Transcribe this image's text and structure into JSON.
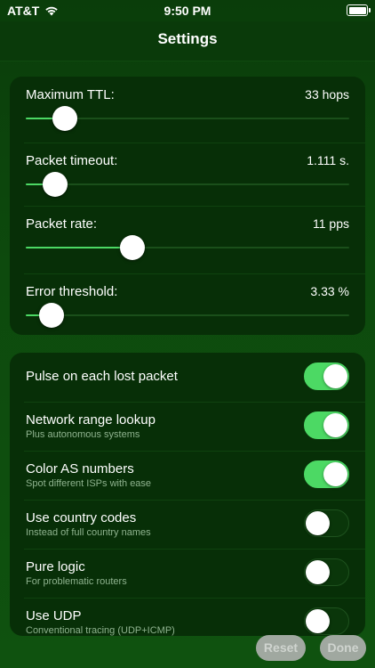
{
  "status": {
    "carrier": "AT&T",
    "time": "9:50 PM"
  },
  "nav": {
    "title": "Settings"
  },
  "sliders": [
    {
      "label": "Maximum TTL:",
      "value": "33 hops",
      "position": 0.12
    },
    {
      "label": "Packet timeout:",
      "value": "1.111 s.",
      "position": 0.09
    },
    {
      "label": "Packet rate:",
      "value": "11 pps",
      "position": 0.33
    },
    {
      "label": "Error threshold:",
      "value": "3.33 %",
      "position": 0.08
    }
  ],
  "toggles": [
    {
      "title": "Pulse on each lost packet",
      "subtitle": "",
      "on": true
    },
    {
      "title": "Network range lookup",
      "subtitle": "Plus autonomous systems",
      "on": true
    },
    {
      "title": "Color AS numbers",
      "subtitle": "Spot different ISPs with ease",
      "on": true
    },
    {
      "title": "Use country codes",
      "subtitle": "Instead of full country names",
      "on": false
    },
    {
      "title": "Pure logic",
      "subtitle": "For problematic routers",
      "on": false
    },
    {
      "title": "Use UDP",
      "subtitle": "Conventional tracing (UDP+ICMP)",
      "on": false
    }
  ],
  "buttons": {
    "reset": "Reset",
    "done": "Done"
  },
  "colors": {
    "accent": "#4cd964",
    "background": "#0d4a0d",
    "card": "#072f07"
  },
  "icons": {
    "wifi": "wifi-icon",
    "battery": "battery-icon"
  }
}
